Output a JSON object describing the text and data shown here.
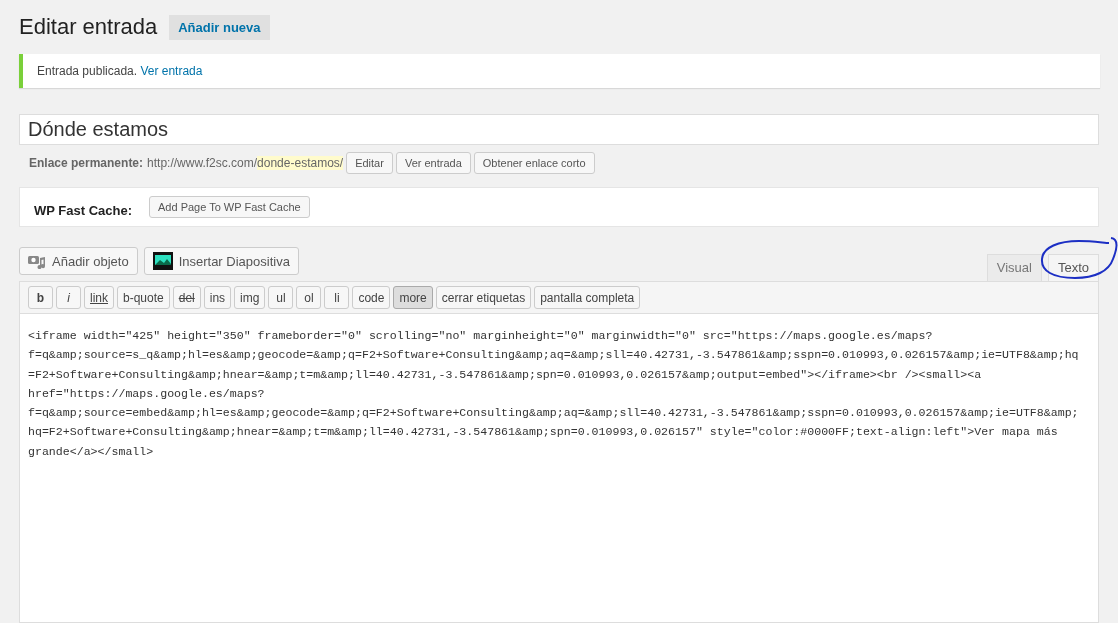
{
  "header": {
    "title": "Editar entrada",
    "add_new": "Añadir nueva"
  },
  "notice": {
    "text": "Entrada publicada.",
    "link": "Ver entrada"
  },
  "post_title": {
    "value": "Dónde estamos"
  },
  "permalink": {
    "label": "Enlace permanente:",
    "base": "http://www.f2sc.com/",
    "slug": "donde-estamos/",
    "buttons": [
      "Editar",
      "Ver entrada",
      "Obtener enlace corto"
    ]
  },
  "fast_cache": {
    "label": "WP Fast Cache:",
    "button": "Add Page To WP Fast Cache"
  },
  "media_buttons": [
    {
      "kind": "media",
      "label": "Añadir objeto"
    },
    {
      "kind": "slides",
      "label": "Insertar Diapositiva"
    }
  ],
  "editor_tabs": [
    {
      "label": "Visual",
      "selected": false
    },
    {
      "label": "Texto",
      "selected": true,
      "circled": true
    }
  ],
  "quicktags": [
    {
      "label": "b",
      "pressed": false
    },
    {
      "label": "i",
      "pressed": false
    },
    {
      "label": "link",
      "pressed": false
    },
    {
      "label": "b-quote",
      "pressed": false
    },
    {
      "label": "del",
      "pressed": false
    },
    {
      "label": "ins",
      "pressed": false
    },
    {
      "label": "img",
      "pressed": false
    },
    {
      "label": "ul",
      "pressed": false
    },
    {
      "label": "ol",
      "pressed": false
    },
    {
      "label": "li",
      "pressed": false
    },
    {
      "label": "code",
      "pressed": false
    },
    {
      "label": "more",
      "pressed": true
    },
    {
      "label": "cerrar etiquetas",
      "pressed": false
    },
    {
      "label": "pantalla completa",
      "pressed": false
    }
  ],
  "content_lines": [
    "<iframe width=\"425\" height=\"350\" frameborder=\"0\" scrolling=\"no\" marginheight=\"0\" marginwidth=\"0\" src=\"https://maps.google.es/maps?",
    "f=q&amp;source=s_q&amp;hl=es&amp;geocode=&amp;q=F2+Software+Consulting&amp;aq=&amp;sll=40.42731,-3.547861&amp;sspn=0.010993,0.026157&amp;ie=UTF8&amp;hq",
    "=F2+Software+Consulting&amp;hnear=&amp;t=m&amp;ll=40.42731,-3.547861&amp;spn=0.010993,0.026157&amp;output=embed\"></iframe><br /><small><a",
    "href=\"https://maps.google.es/maps?",
    "f=q&amp;source=embed&amp;hl=es&amp;geocode=&amp;q=F2+Software+Consulting&amp;aq=&amp;sll=40.42731,-3.547861&amp;sspn=0.010993,0.026157&amp;ie=UTF8&amp;",
    "hq=F2+Software+Consulting&amp;hnear=&amp;t=m&amp;ll=40.42731,-3.547861&amp;spn=0.010993,0.026157\" style=\"color:#0000FF;text-align:left\">Ver mapa más",
    "grande</a></small>"
  ]
}
